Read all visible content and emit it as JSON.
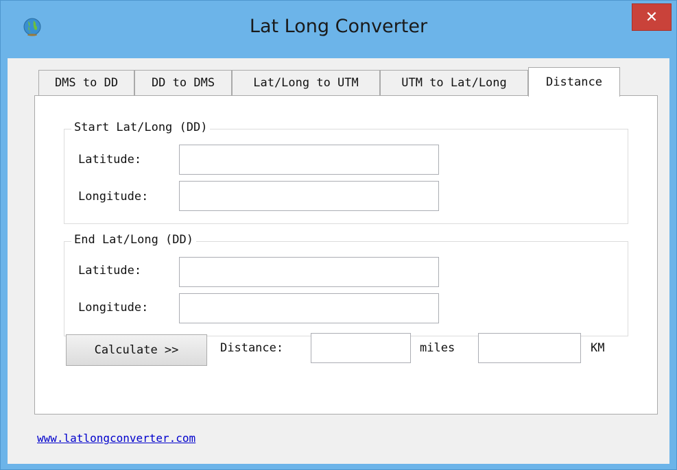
{
  "window": {
    "title": "Lat Long Converter",
    "close_label": "✕"
  },
  "tabs": [
    {
      "label": "DMS to DD"
    },
    {
      "label": "DD to DMS"
    },
    {
      "label": "Lat/Long to UTM"
    },
    {
      "label": "UTM to Lat/Long"
    },
    {
      "label": "Distance"
    }
  ],
  "active_tab": "Distance",
  "start": {
    "group_title": "Start Lat/Long (DD)",
    "latitude_label": "Latitude:",
    "latitude_value": "",
    "longitude_label": "Longitude:",
    "longitude_value": ""
  },
  "end": {
    "group_title": "End Lat/Long (DD)",
    "latitude_label": "Latitude:",
    "latitude_value": "",
    "longitude_label": "Longitude:",
    "longitude_value": ""
  },
  "calculate": {
    "button_label": "Calculate >>",
    "distance_label": "Distance:",
    "miles_value": "",
    "miles_unit": "miles",
    "km_value": "",
    "km_unit": "KM"
  },
  "footer": {
    "link_text": "www.latlongconverter.com"
  },
  "colors": {
    "frame": "#6cb4e9",
    "close": "#c9423a",
    "link": "#0000cc"
  }
}
